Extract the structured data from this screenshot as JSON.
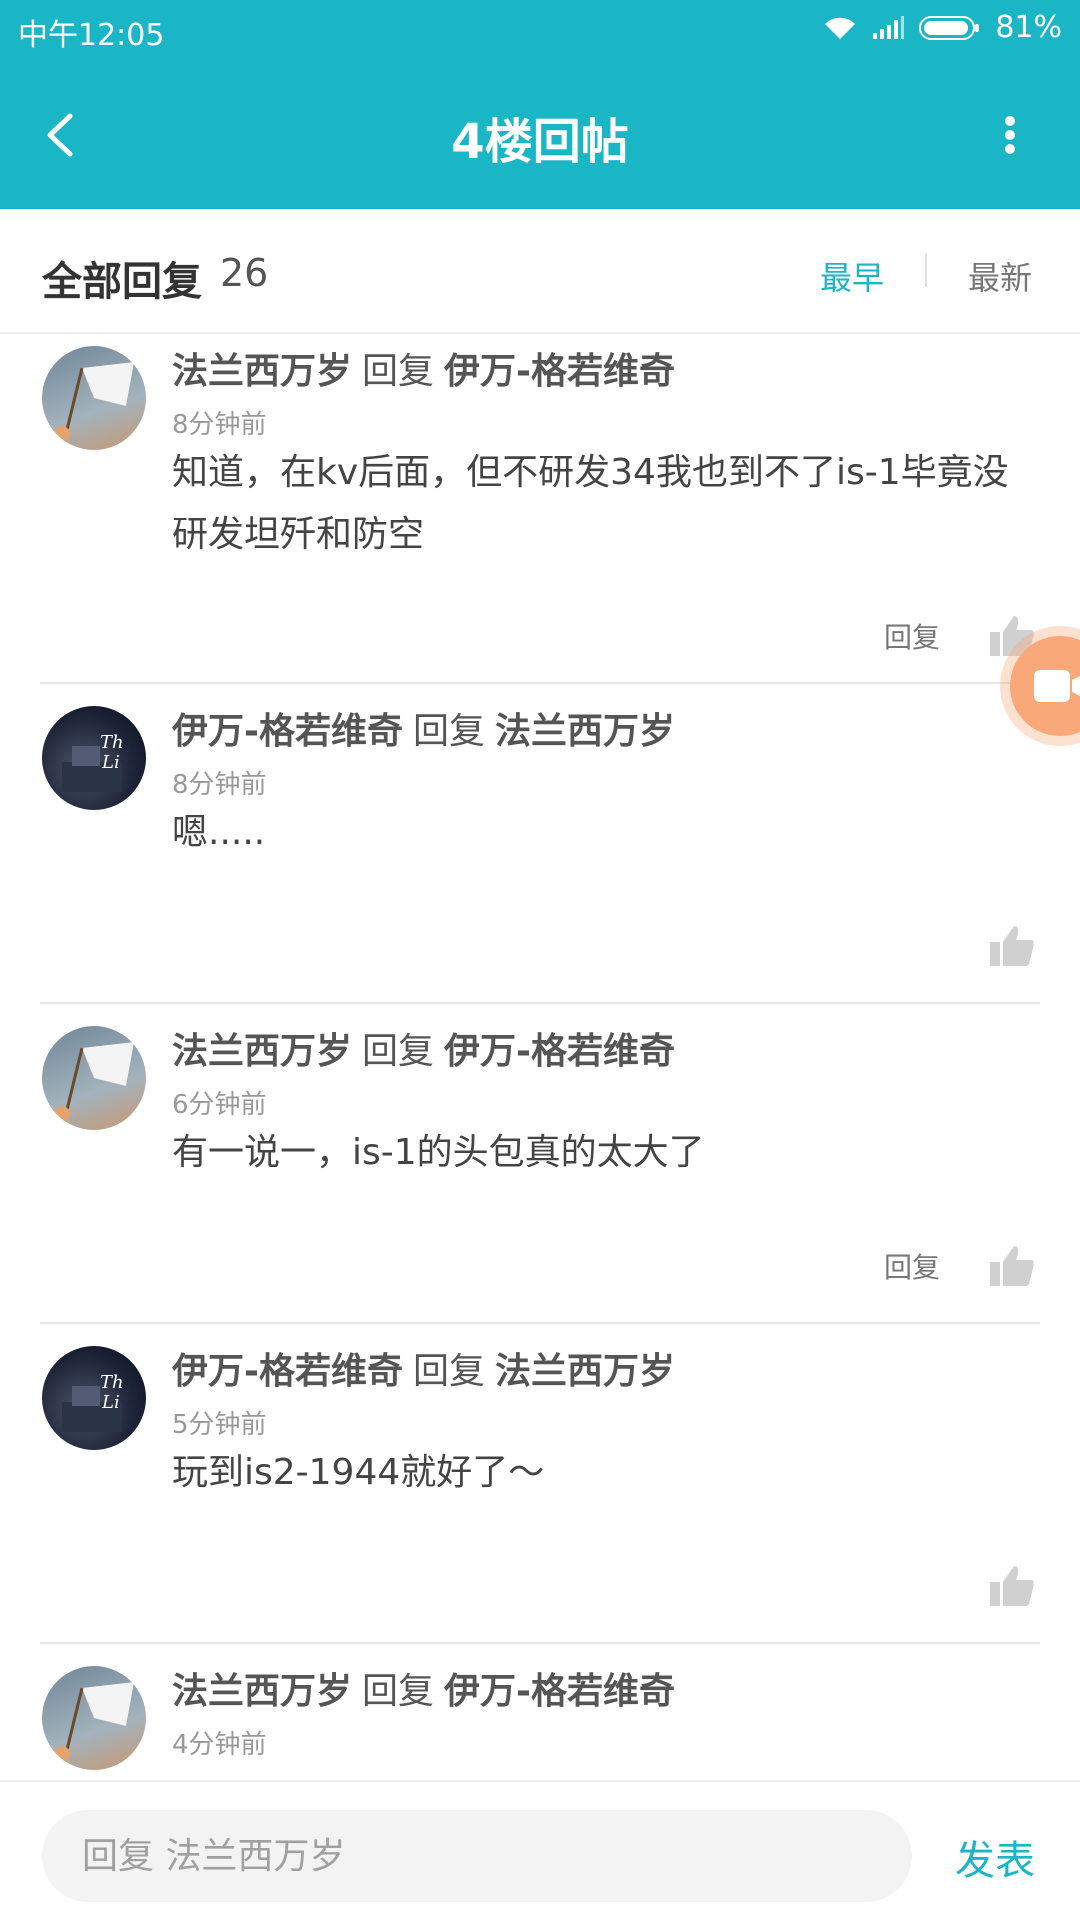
{
  "status": {
    "time": "中午12:05",
    "battery": "81%"
  },
  "header": {
    "title": "4楼回帖"
  },
  "sort": {
    "label": "全部回复",
    "count": "26",
    "earliest": "最早",
    "latest": "最新"
  },
  "replies": [
    {
      "author": "法兰西万岁",
      "verb": "回复",
      "target": "伊万-格若维奇",
      "time": "8分钟前",
      "text": "知道，在kv后面，但不研发34我也到不了is-1毕竟没研发坦歼和防空",
      "reply_label": "回复",
      "avatar": "flag-avatar"
    },
    {
      "author": "伊万-格若维奇",
      "verb": "回复",
      "target": "法兰西万岁",
      "time": "8分钟前",
      "text": "嗯.....",
      "reply_label": "",
      "avatar": "dark-avatar"
    },
    {
      "author": "法兰西万岁",
      "verb": "回复",
      "target": "伊万-格若维奇",
      "time": "6分钟前",
      "text": "有一说一，is-1的头包真的太大了",
      "reply_label": "回复",
      "avatar": "flag-avatar"
    },
    {
      "author": "伊万-格若维奇",
      "verb": "回复",
      "target": "法兰西万岁",
      "time": "5分钟前",
      "text": "玩到is2-1944就好了～",
      "reply_label": "",
      "avatar": "dark-avatar"
    },
    {
      "author": "法兰西万岁",
      "verb": "回复",
      "target": "伊万-格若维奇",
      "time": "4分钟前",
      "text": "",
      "reply_label": "",
      "avatar": "flag-avatar"
    }
  ],
  "bottom": {
    "input_placeholder": "回复 法兰西万岁",
    "send": "发表"
  },
  "colors": {
    "accent": "#1ab6c6",
    "float_button": "#f9a879"
  }
}
